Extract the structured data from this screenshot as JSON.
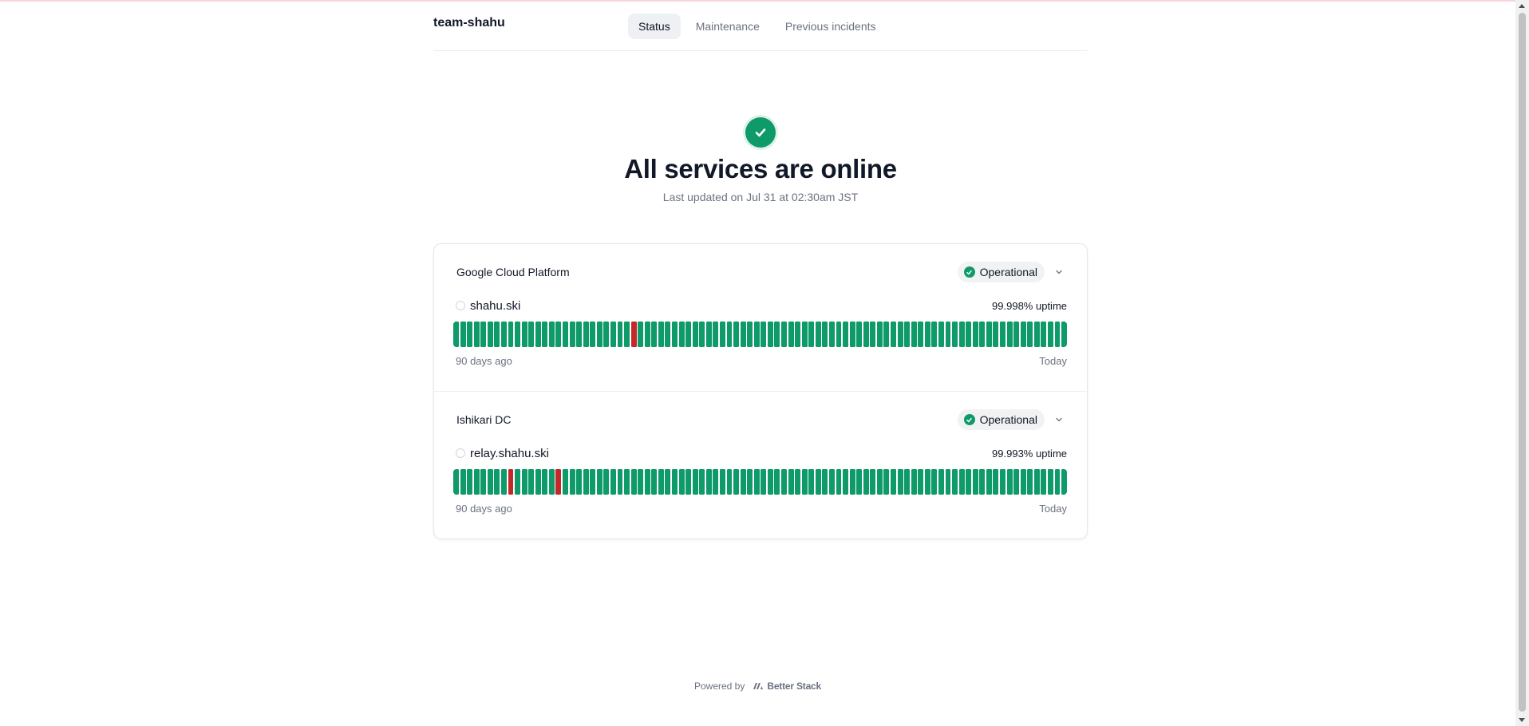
{
  "brand": "team-shahu",
  "nav": {
    "tabs": [
      {
        "label": "Status",
        "active": true
      },
      {
        "label": "Maintenance",
        "active": false
      },
      {
        "label": "Previous incidents",
        "active": false
      }
    ]
  },
  "hero": {
    "title": "All services are online",
    "subtitle": "Last updated on Jul 31 at 02:30am JST"
  },
  "groups": [
    {
      "name": "Google Cloud Platform",
      "status": "Operational",
      "monitor": {
        "name": "shahu.ski",
        "uptime": "99.998% uptime",
        "range_start": "90 days ago",
        "range_end": "Today",
        "day_count": 90,
        "down_days": [
          26
        ]
      }
    },
    {
      "name": "Ishikari DC",
      "status": "Operational",
      "monitor": {
        "name": "relay.shahu.ski",
        "uptime": "99.993% uptime",
        "range_start": "90 days ago",
        "range_end": "Today",
        "day_count": 90,
        "down_days": [
          8,
          15
        ]
      }
    }
  ],
  "footer": {
    "powered_by": "Powered by",
    "logo_text": "Better Stack"
  },
  "colors": {
    "operational": "#0f9a6a",
    "down": "#c4282a"
  },
  "icons": {
    "hero": "check-circle-icon",
    "badge": "check-circle-icon",
    "expand": "chevron-down-icon",
    "monitor": "circle-outline-icon",
    "footer_logo": "betterstack-logo"
  }
}
